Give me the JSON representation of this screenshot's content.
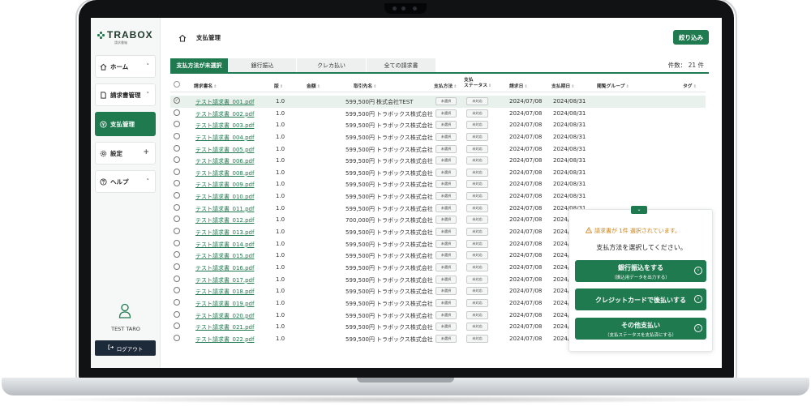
{
  "app": {
    "logo": "TRABOX",
    "logo_sub": "請求書箱"
  },
  "sidebar": {
    "items": [
      {
        "label": "ホーム",
        "icon": "home-icon",
        "chevron": "˅"
      },
      {
        "label": "請求書管理",
        "icon": "document-icon",
        "chevron": "˅"
      },
      {
        "label": "支払管理",
        "icon": "payment-icon",
        "chevron": ""
      },
      {
        "label": "設定",
        "icon": "gear-icon",
        "chevron": "+"
      },
      {
        "label": "ヘルプ",
        "icon": "help-icon",
        "chevron": "˅"
      }
    ],
    "user_name": "TEST TARO",
    "logout_label": "ログアウト"
  },
  "header": {
    "title": "支払管理",
    "filter_label": "絞り込み"
  },
  "tabs": [
    "支払方法が未選択",
    "銀行振込",
    "クレカ払い",
    "全ての請求書"
  ],
  "count_text": "件数： 21 件",
  "columns": {
    "name": "請求書名",
    "version": "版",
    "amount": "金額",
    "payee": "取引先名",
    "pay_method": "支払方法",
    "pay_status_1": "支払",
    "pay_status_2": "ステータス",
    "invoice_date": "請求日",
    "due_date": "支払期日",
    "group": "閲覧グループ",
    "tag": "タグ"
  },
  "pill_labels": {
    "method": "未選択",
    "status": "未対応"
  },
  "rows": [
    {
      "name": "テスト請求書_001.pdf",
      "version": "1.0",
      "amount": "599,500円",
      "payee": "株式会社TEST",
      "invoice_date": "2024/07/08",
      "due_date": "2024/08/31",
      "check": "✓"
    },
    {
      "name": "テスト請求書_002.pdf",
      "version": "1.0",
      "amount": "599,500円",
      "payee": "トラボックス株式会社",
      "invoice_date": "2024/07/08",
      "due_date": "2024/08/31"
    },
    {
      "name": "テスト請求書_003.pdf",
      "version": "1.0",
      "amount": "599,500円",
      "payee": "トラボックス株式会社",
      "invoice_date": "2024/07/08",
      "due_date": "2024/08/31"
    },
    {
      "name": "テスト請求書_004.pdf",
      "version": "1.0",
      "amount": "599,500円",
      "payee": "トラボックス株式会社",
      "invoice_date": "2024/07/08",
      "due_date": "2024/08/31"
    },
    {
      "name": "テスト請求書_005.pdf",
      "version": "1.0",
      "amount": "599,500円",
      "payee": "トラボックス株式会社",
      "invoice_date": "2024/07/08",
      "due_date": "2024/08/31"
    },
    {
      "name": "テスト請求書_006.pdf",
      "version": "1.0",
      "amount": "599,500円",
      "payee": "トラボックス株式会社",
      "invoice_date": "2024/07/08",
      "due_date": "2024/08/31"
    },
    {
      "name": "テスト請求書_008.pdf",
      "version": "1.0",
      "amount": "599,500円",
      "payee": "トラボックス株式会社",
      "invoice_date": "2024/07/08",
      "due_date": "2024/08/31"
    },
    {
      "name": "テスト請求書_009.pdf",
      "version": "1.0",
      "amount": "599,500円",
      "payee": "トラボックス株式会社",
      "invoice_date": "2024/07/08",
      "due_date": "2024/08/31"
    },
    {
      "name": "テスト請求書_010.pdf",
      "version": "1.0",
      "amount": "599,500円",
      "payee": "トラボックス株式会社",
      "invoice_date": "2024/07/08",
      "due_date": "2024/08/31"
    },
    {
      "name": "テスト請求書_011.pdf",
      "version": "1.0",
      "amount": "599,500円",
      "payee": "トラボックス株式会社",
      "invoice_date": "2024/07/08",
      "due_date": "2024/08/31"
    },
    {
      "name": "テスト請求書_012.pdf",
      "version": "1.0",
      "amount": "700,000円",
      "payee": "トラボックス株式会社",
      "invoice_date": "2024/07/08",
      "due_date": "2024/08/31"
    },
    {
      "name": "テスト請求書_013.pdf",
      "version": "1.0",
      "amount": "599,500円",
      "payee": "トラボックス株式会社",
      "invoice_date": "2024/07/08",
      "due_date": "2024/08/31"
    },
    {
      "name": "テスト請求書_014.pdf",
      "version": "1.0",
      "amount": "599,500円",
      "payee": "トラボックス株式会社",
      "invoice_date": "2024/07/08",
      "due_date": "2024/08/31"
    },
    {
      "name": "テスト請求書_015.pdf",
      "version": "1.0",
      "amount": "599,500円",
      "payee": "トラボックス株式会社",
      "invoice_date": "2024/07/08",
      "due_date": "2024/08/31"
    },
    {
      "name": "テスト請求書_016.pdf",
      "version": "1.0",
      "amount": "599,500円",
      "payee": "トラボックス株式会社",
      "invoice_date": "2024/07/08",
      "due_date": "2024/08/31"
    },
    {
      "name": "テスト請求書_017.pdf",
      "version": "1.0",
      "amount": "599,500円",
      "payee": "トラボックス株式会社",
      "invoice_date": "2024/07/08",
      "due_date": "2024/08/31"
    },
    {
      "name": "テスト請求書_018.pdf",
      "version": "1.0",
      "amount": "599,500円",
      "payee": "トラボックス株式会社",
      "invoice_date": "2024/07/08",
      "due_date": "2024/08/31"
    },
    {
      "name": "テスト請求書_019.pdf",
      "version": "1.0",
      "amount": "599,500円",
      "payee": "トラボックス株式会社",
      "invoice_date": "2024/07/08",
      "due_date": "2024/08/31"
    },
    {
      "name": "テスト請求書_020.pdf",
      "version": "1.0",
      "amount": "599,500円",
      "payee": "トラボックス株式会社",
      "invoice_date": "2024/07/08",
      "due_date": "2024/08/31"
    },
    {
      "name": "テスト請求書_021.pdf",
      "version": "1.0",
      "amount": "599,500円",
      "payee": "トラボックス株式会社",
      "invoice_date": "2024/07/08",
      "due_date": "2024/08/31"
    },
    {
      "name": "テスト請求書_022.pdf",
      "version": "1.0",
      "amount": "599,500円",
      "payee": "トラボックス株式会社",
      "invoice_date": "2024/07/08",
      "due_date": "2024/08/31"
    }
  ],
  "panel": {
    "toggle": "⌄",
    "warning": "請求書が 1件 選択されています。",
    "message": "支払方法を選択してください。",
    "buttons": [
      {
        "label": "銀行振込をする",
        "sub": "（振込用データを出力する）"
      },
      {
        "label": "クレジットカードで後払いする",
        "sub": ""
      },
      {
        "label": "その他支払い",
        "sub": "（支払ステータスを支払済にする）"
      }
    ]
  },
  "colors": {
    "accent": "#1f7a4f",
    "warning": "#c9811a",
    "logout_bg": "#1d2a3a"
  }
}
